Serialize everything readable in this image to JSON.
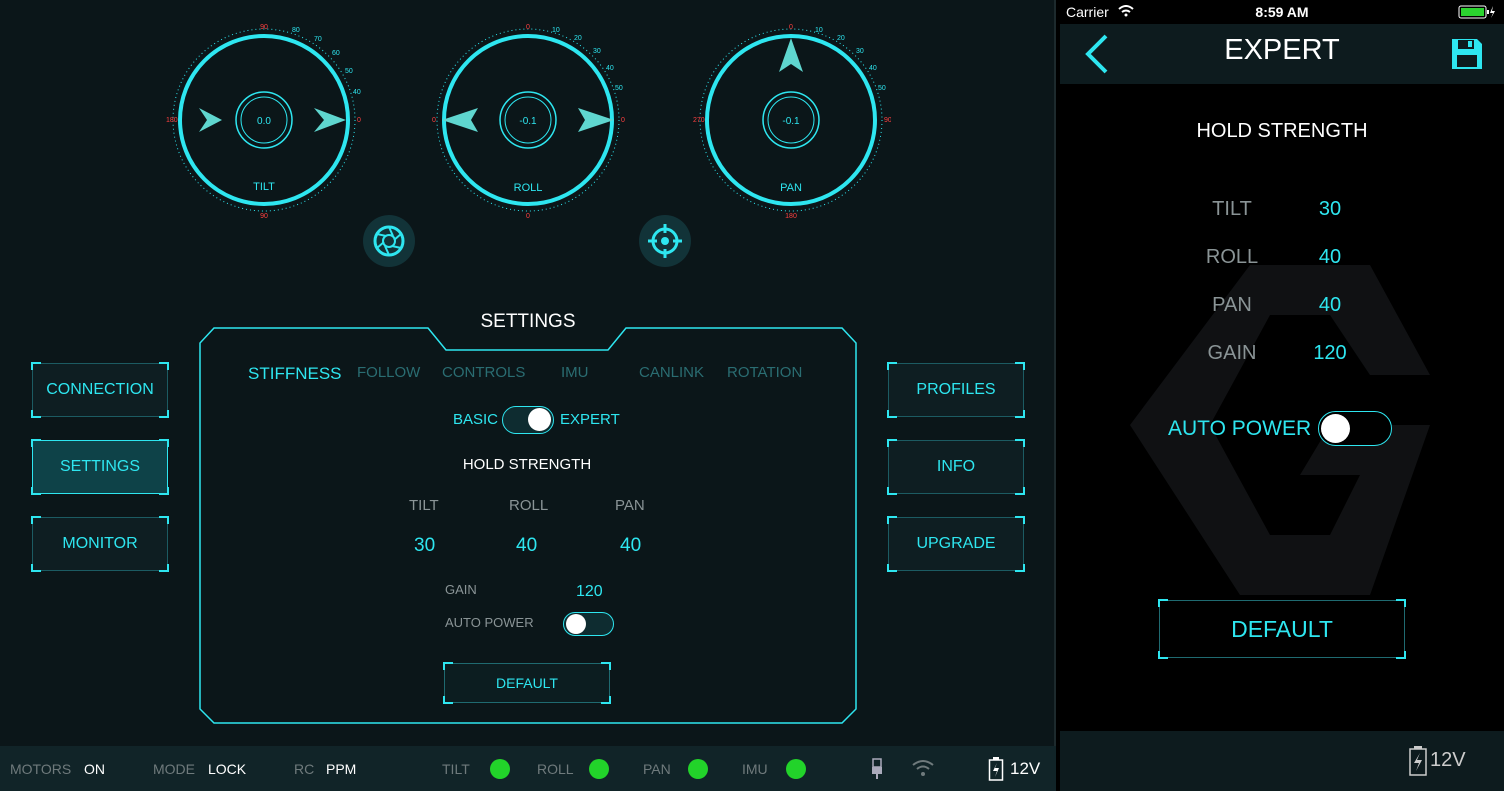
{
  "dials": [
    {
      "value": "0.0",
      "label": "TILT"
    },
    {
      "value": "-0.1",
      "label": "ROLL"
    },
    {
      "value": "-0.1",
      "label": "PAN"
    }
  ],
  "dial_ticks": {
    "tilt_top": [
      "90",
      "80",
      "70",
      "60",
      "50",
      "40",
      "30",
      "20",
      "10",
      "0"
    ],
    "tilt_red": "90",
    "roll_top": [
      "0",
      "10",
      "20",
      "30",
      "40",
      "50",
      "60",
      "70",
      "80",
      "90"
    ],
    "pan_top": [
      "0",
      "10",
      "20",
      "30",
      "40",
      "50",
      "60",
      "70",
      "80",
      "90"
    ],
    "pan_left": "270",
    "pan_bottom": "180"
  },
  "icons": {
    "aperture": "aperture-icon",
    "target": "crosshair-icon"
  },
  "nav_left": [
    {
      "label": "CONNECTION"
    },
    {
      "label": "SETTINGS",
      "active": true
    },
    {
      "label": "MONITOR"
    }
  ],
  "nav_right": [
    {
      "label": "PROFILES"
    },
    {
      "label": "INFO"
    },
    {
      "label": "UPGRADE"
    }
  ],
  "settings": {
    "title": "SETTINGS",
    "tabs": [
      "STIFFNESS",
      "FOLLOW",
      "CONTROLS",
      "IMU",
      "CANLINK",
      "ROTATION"
    ],
    "active_tab": "STIFFNESS",
    "mode_basic": "BASIC",
    "mode_expert": "EXPERT",
    "hold_title": "HOLD STRENGTH",
    "axes": [
      {
        "label": "TILT",
        "value": "30"
      },
      {
        "label": "ROLL",
        "value": "40"
      },
      {
        "label": "PAN",
        "value": "40"
      }
    ],
    "gain_label": "GAIN",
    "gain_value": "120",
    "auto_power_label": "AUTO POWER",
    "default_label": "DEFAULT"
  },
  "status": {
    "motors_k": "MOTORS",
    "motors_v": "ON",
    "mode_k": "MODE",
    "mode_v": "LOCK",
    "rc_k": "RC",
    "rc_v": "PPM",
    "leds": [
      "TILT",
      "ROLL",
      "PAN",
      "IMU"
    ],
    "voltage": "12V"
  },
  "phone": {
    "carrier": "Carrier",
    "time": "8:59 AM",
    "title": "EXPERT",
    "hold_title": "HOLD STRENGTH",
    "rows": [
      {
        "label": "TILT",
        "value": "30"
      },
      {
        "label": "ROLL",
        "value": "40"
      },
      {
        "label": "PAN",
        "value": "40"
      },
      {
        "label": "GAIN",
        "value": "120"
      }
    ],
    "auto_power_label": "AUTO POWER",
    "default_label": "DEFAULT",
    "voltage": "12V"
  },
  "colors": {
    "accent": "#2ee6f0",
    "led": "#22d32a",
    "panel": "#0b1619"
  }
}
